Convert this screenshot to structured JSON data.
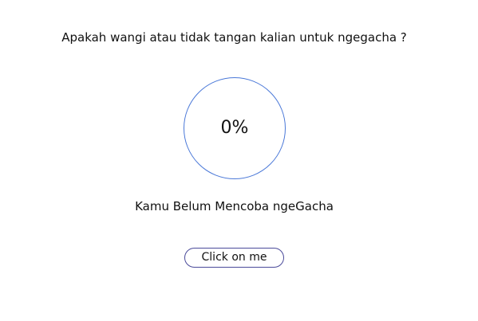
{
  "question": "Apakah wangi atau tidak tangan kalian untuk ngegacha ?",
  "progress": {
    "label": "0%",
    "value": 0
  },
  "status": "Kamu Belum Mencoba ngeGacha",
  "button": {
    "label": "Click on me"
  },
  "colors": {
    "ring": "#4a78d8",
    "button_border": "#4a4a9a",
    "text": "#111111",
    "background": "#ffffff"
  }
}
